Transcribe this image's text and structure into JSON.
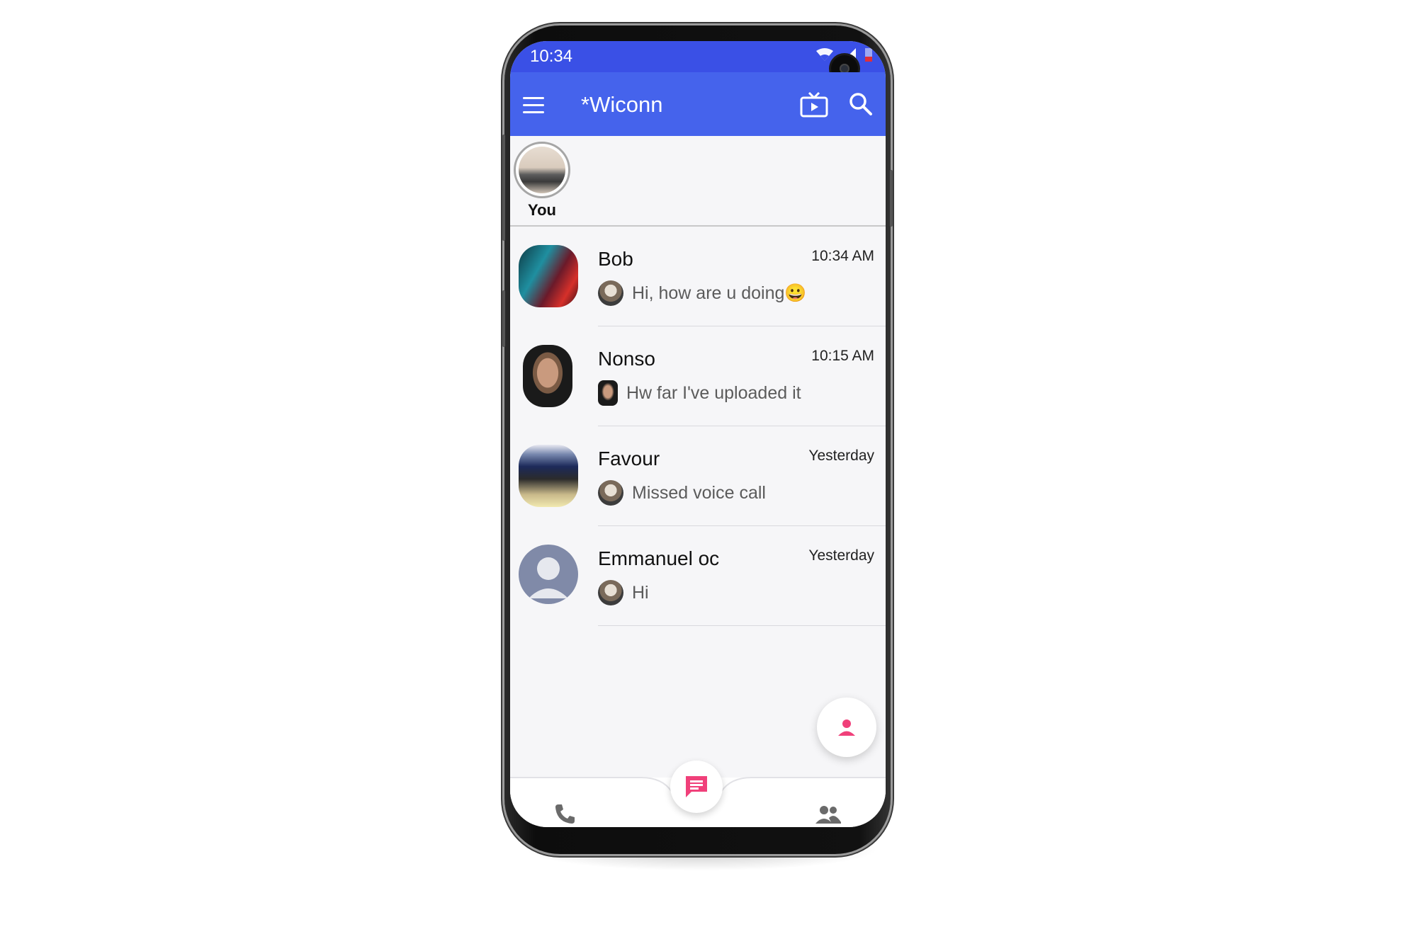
{
  "status_bar": {
    "time": "10:34",
    "icons": [
      "wifi-icon",
      "signal-icon",
      "battery-icon"
    ]
  },
  "app_bar": {
    "title": "*Wiconn",
    "icons": [
      "menu-icon",
      "tv-icon",
      "search-icon"
    ],
    "color": "#4563ec"
  },
  "status_strip": {
    "you_label": "You"
  },
  "chats": [
    {
      "name": "Bob",
      "time": "10:34 AM",
      "message": "Hi, how are u doing😀"
    },
    {
      "name": "Nonso",
      "time": "10:15 AM",
      "message": "Hw far I've uploaded it"
    },
    {
      "name": "Favour",
      "time": "Yesterday",
      "message": "Missed voice call"
    },
    {
      "name": "Emmanuel oc",
      "time": "Yesterday",
      "message": "Hi"
    }
  ],
  "bottom_nav": {
    "items": [
      "phone-icon",
      "chat-icon",
      "group-icon"
    ],
    "accent": "#f0407a"
  }
}
